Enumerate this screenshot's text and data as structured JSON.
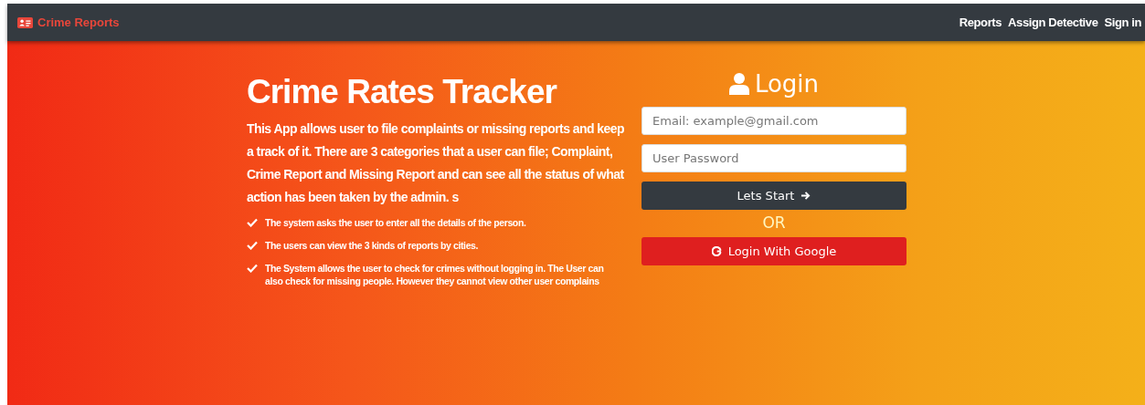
{
  "navbar": {
    "brand": "Crime Reports",
    "links": [
      "Reports",
      "Assign Detective",
      "Sign in"
    ]
  },
  "intro": {
    "title": "Crime Rates Tracker",
    "description": "This App allows user to file complaints or missing reports and keep a track of it. There are 3 categories that a user can file; Complaint, Crime Report and Missing Report and can see all the status of what action has been taken by the admin. s",
    "features": [
      "The system asks the user to enter all the details of the person.",
      "The users can view the 3 kinds of reports by cities.",
      "The System allows the user to check for crimes without logging in. The User can also check for missing people. However they cannot view other user complains"
    ]
  },
  "login": {
    "title": "Login",
    "email": {
      "placeholder": "Email: example@gmail.com"
    },
    "password": {
      "placeholder": "User Password"
    },
    "submit": "Lets Start",
    "separator": "OR",
    "google": "Login With Google"
  }
}
